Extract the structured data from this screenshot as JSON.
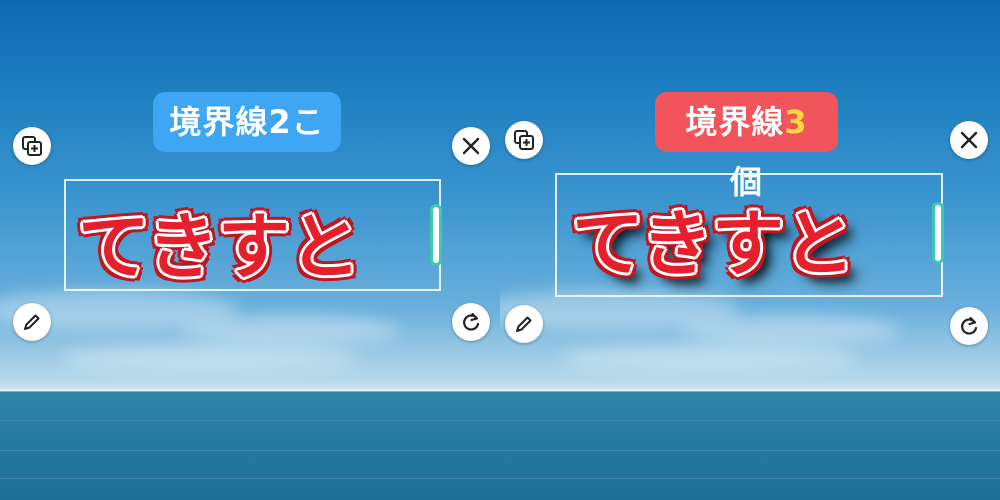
{
  "left": {
    "label": "境界線2こ",
    "text": "てきすと"
  },
  "right": {
    "label_prefix": "境界線",
    "label_num": "3",
    "label_suffix": "個",
    "text": "てきすと"
  },
  "icons": {
    "duplicate": "duplicate-icon",
    "close": "close-icon",
    "edit": "pencil-icon",
    "rotate": "rotate-icon"
  },
  "colors": {
    "blue_label": "#3ea6f2",
    "red_label": "#f2545b",
    "text_fill": "#e5202c",
    "handle": "#3fc7b0"
  }
}
